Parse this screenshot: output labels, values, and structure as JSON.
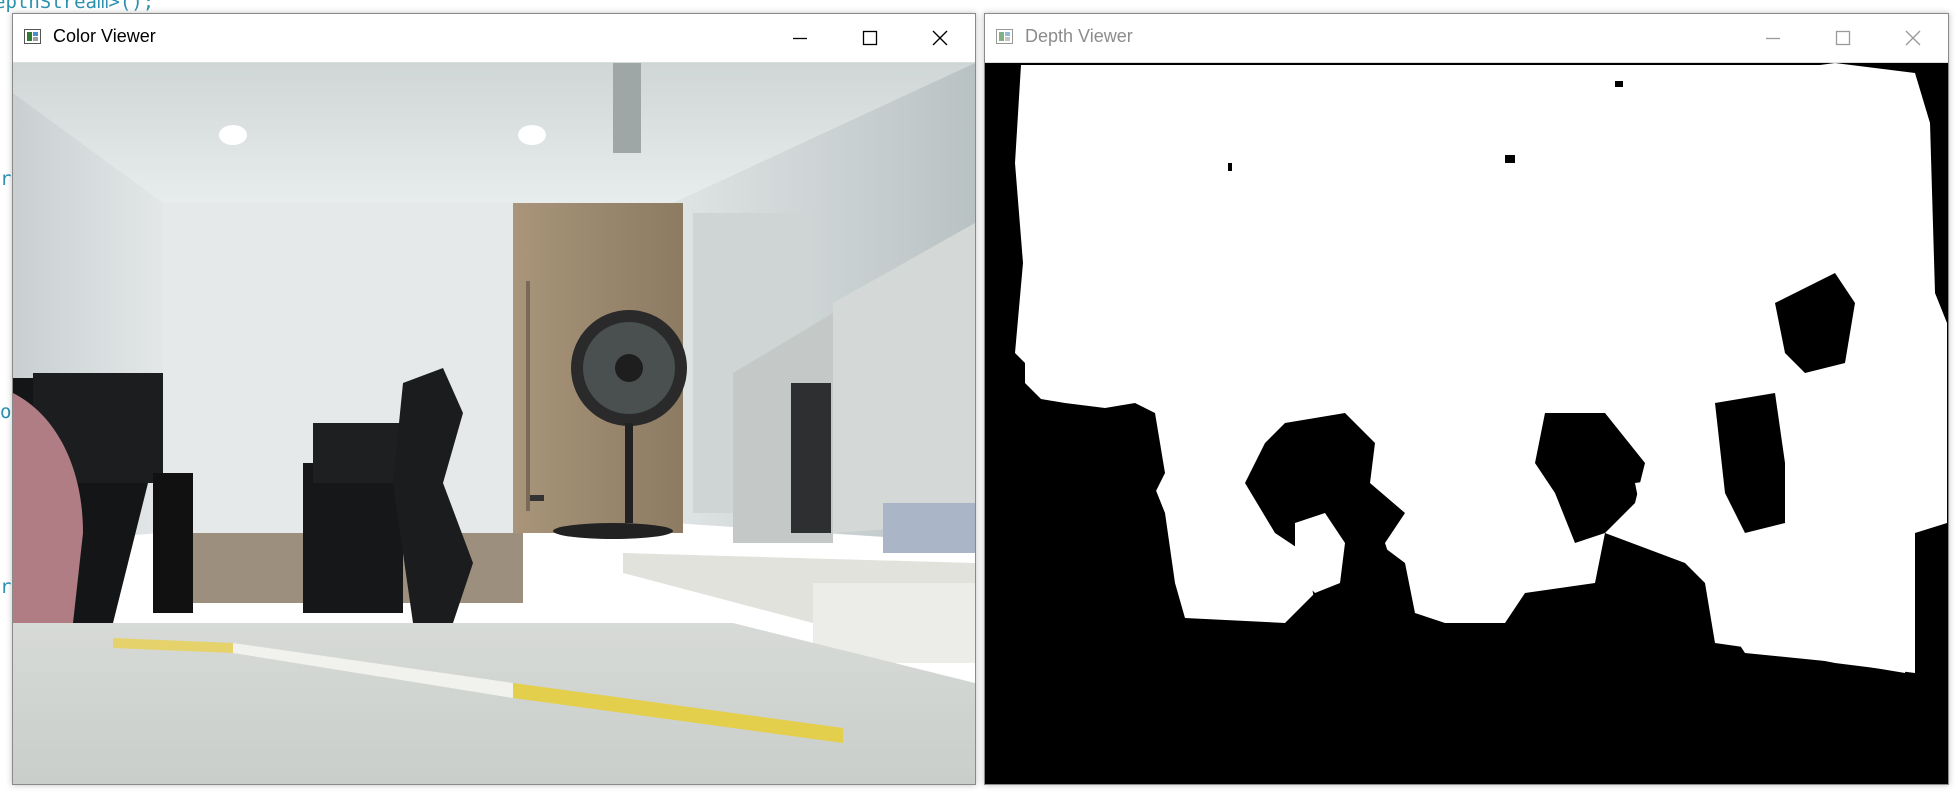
{
  "editor": {
    "code_text": "epthStream>();",
    "fragments": [
      "r",
      "o",
      "r"
    ]
  },
  "windows": [
    {
      "title": "Color Viewer",
      "active": true,
      "content": "camera-color-frame"
    },
    {
      "title": "Depth Viewer",
      "active": false,
      "content": "camera-depth-frame"
    }
  ],
  "controls": {
    "minimize": "minimize-icon",
    "maximize": "maximize-icon",
    "close": "close-icon"
  },
  "colors": {
    "depth_near": "#000000",
    "depth_far": "#ffffff",
    "code_text": "#2b91af"
  }
}
